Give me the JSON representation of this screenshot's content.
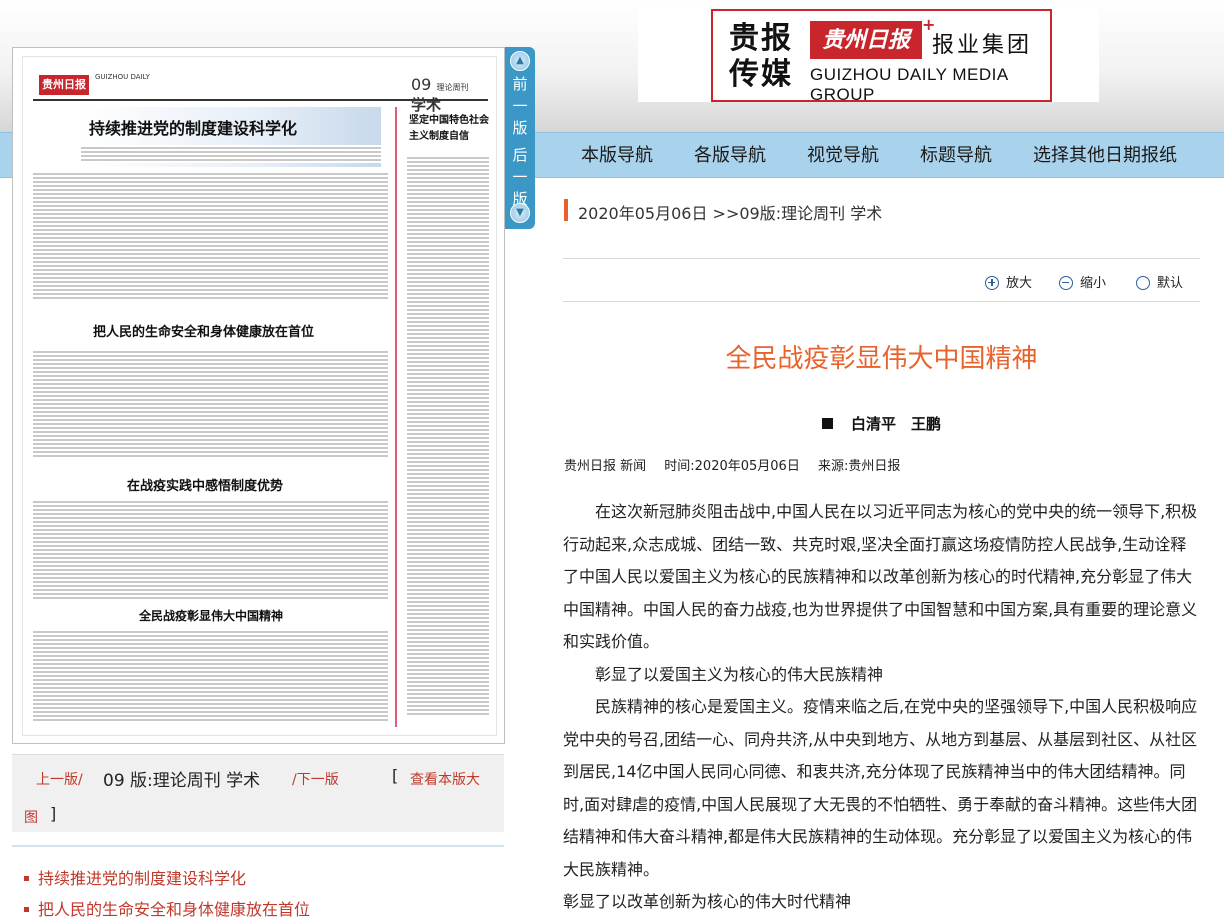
{
  "logo": {
    "chars": "贵报\n传媒",
    "brand_red": "贵州日报",
    "plus": "+",
    "group": "报业集团",
    "english": "GUIZHOU DAILY MEDIA GROUP"
  },
  "nav": {
    "items": [
      "本版导航",
      "各版导航",
      "视觉导航",
      "标题导航",
      "选择其他日期报纸"
    ]
  },
  "breadcrumb": {
    "date": "2020年05月06日",
    "section": ">>09版:理论周刊 学术"
  },
  "zoom": {
    "enlarge": "放大",
    "shrink": "缩小",
    "default": "默认"
  },
  "article": {
    "title": "全民战疫彰显伟大中国精神",
    "authors": "白清平　王鹏",
    "meta_source": "贵州日报 新闻",
    "meta_time": "时间:2020年05月06日",
    "meta_origin": "来源:贵州日报",
    "paragraphs": [
      {
        "text": "在这次新冠肺炎阻击战中,中国人民在以习近平同志为核心的党中央的统一领导下,积极行动起来,众志成城、团结一致、共克时艰,坚决全面打赢这场疫情防控人民战争,生动诠释了中国人民以爱国主义为核心的民族精神和以改革创新为核心的时代精神,充分彰显了伟大中国精神。中国人民的奋力战疫,也为世界提供了中国智慧和中国方案,具有重要的理论意义和实践价值。",
        "indent": true
      },
      {
        "text": "彰显了以爱国主义为核心的伟大民族精神",
        "indent": true
      },
      {
        "text": "民族精神的核心是爱国主义。疫情来临之后,在党中央的坚强领导下,中国人民积极响应党中央的号召,团结一心、同舟共济,从中央到地方、从地方到基层、从基层到社区、从社区到居民,14亿中国人民同心同德、和衷共济,充分体现了民族精神当中的伟大团结精神。同时,面对肆虐的疫情,中国人民展现了大无畏的不怕牺牲、勇于奉献的奋斗精神。这些伟大团结精神和伟大奋斗精神,都是伟大民族精神的生动体现。充分彰显了以爱国主义为核心的伟大民族精神。",
        "indent": true
      },
      {
        "text": "彰显了以改革创新为核心的伟大时代精神",
        "indent": false
      }
    ]
  },
  "vnav": {
    "prev": "前一版",
    "next": "后一版"
  },
  "paper_thumb": {
    "logo": "贵州日报",
    "english": "GUIZHOU DAILY",
    "edition": "09",
    "column_tag": "理论周刊",
    "section": "学术",
    "headlines": [
      "持续推进党的制度建设科学化",
      "把人民的生命安全和身体健康放在首位",
      "在战疫实践中感悟制度优势",
      "全民战疫彰显伟大中国精神"
    ],
    "sidebar_headline": "坚定中国特色社会主义制度自信"
  },
  "pager": {
    "prev": "上一版/",
    "edition": "09 版:理论周刊 学术",
    "next": "/下一版",
    "bracket_open": "[",
    "view_big_1": "查看本版大",
    "view_big_2": "图",
    "bracket_close": "]"
  },
  "title_list": [
    "持续推进党的制度建设科学化",
    "把人民的生命安全和身体健康放在首位"
  ],
  "colors": {
    "accent": "#e8622c",
    "link_red": "#c0392b",
    "nav_band": "#a9d3ec",
    "vnav_blue": "#3a97c6",
    "brand_red": "#c9252d"
  }
}
